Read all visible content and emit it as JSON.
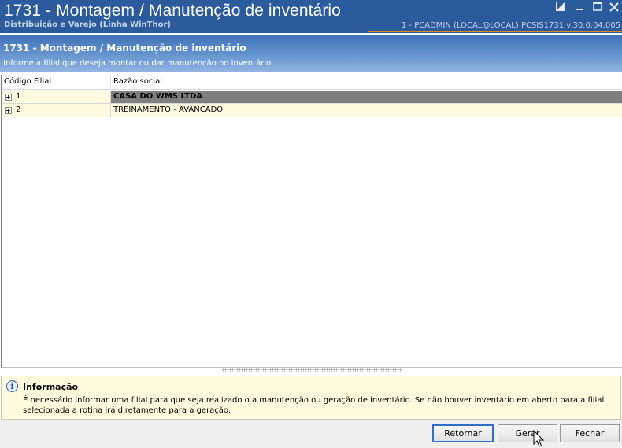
{
  "window": {
    "title": "1731 - Montagem / Manutenção de inventário",
    "subtitle": "Distribuição e Varejo (Linha WinThor)",
    "session_info": "1 - PCADMIN (LOCAL@LOCAL)   PCSIS1731  v.30.0.04.005",
    "controls": [
      "restore-icon",
      "minimize-icon",
      "maximize-icon",
      "close-icon"
    ]
  },
  "header": {
    "title": "1731 - Montagem / Manutenção de inventário",
    "description": "Informe a filial que deseja montar ou dar manutenção no inventário"
  },
  "grid": {
    "columns": [
      "Código Filial",
      "Razão social"
    ],
    "rows": [
      {
        "code": "1",
        "name": "CASA DO WMS LTDA",
        "selected": true
      },
      {
        "code": "2",
        "name": "TREINAMENTO - AVANCADO",
        "selected": false
      }
    ]
  },
  "info": {
    "title": "Informação",
    "text": "É necessário informar uma filial para que seja realizado o a manutenção ou geração de inventário. Se não houver inventário em aberto para a filial selecionada a rotina irá diretamente para a geração."
  },
  "buttons": {
    "retornar": "Retornar",
    "gerar": "Gerar",
    "fechar": "Fechar"
  },
  "colors": {
    "titlebar": "#2b5b9c",
    "accent_orange": "#e08a16",
    "row_background": "#fffbe0",
    "selected_cell": "#7f7f7f"
  }
}
